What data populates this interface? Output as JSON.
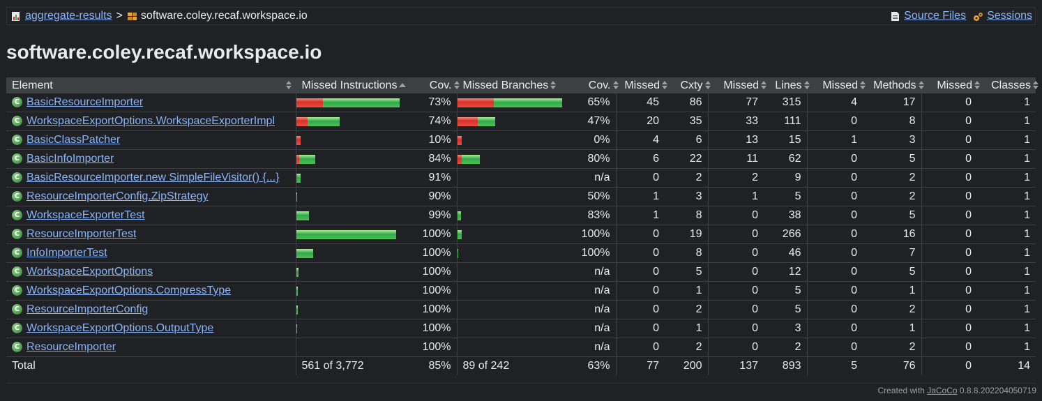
{
  "breadcrumb": {
    "root": "aggregate-results",
    "separator": ">",
    "current": "software.coley.recaf.workspace.io",
    "source_files": "Source Files",
    "sessions": "Sessions"
  },
  "page_title": "software.coley.recaf.workspace.io",
  "headers": [
    "Element",
    "Missed Instructions",
    "Cov.",
    "Missed Branches",
    "Cov.",
    "Missed",
    "Cxty",
    "Missed",
    "Lines",
    "Missed",
    "Methods",
    "Missed",
    "Classes"
  ],
  "rows": [
    {
      "name": "BasicResourceImporter",
      "instr": {
        "red": 38,
        "green": 110
      },
      "instr_cov": "73%",
      "br": {
        "red": 52,
        "green": 98
      },
      "br_cov": "65%",
      "cx_missed": "45",
      "cxty": "86",
      "ln_missed": "77",
      "lines": "315",
      "m_missed": "4",
      "methods": "17",
      "c_missed": "0",
      "classes": "1"
    },
    {
      "name": "WorkspaceExportOptions.WorkspaceExporterImpl",
      "instr": {
        "red": 16,
        "green": 46
      },
      "instr_cov": "74%",
      "br": {
        "red": 29,
        "green": 25
      },
      "br_cov": "47%",
      "cx_missed": "20",
      "cxty": "35",
      "ln_missed": "33",
      "lines": "111",
      "m_missed": "0",
      "methods": "8",
      "c_missed": "0",
      "classes": "1"
    },
    {
      "name": "BasicClassPatcher",
      "instr": {
        "red": 6,
        "green": 0
      },
      "instr_cov": "10%",
      "br": {
        "red": 6,
        "green": 0
      },
      "br_cov": "0%",
      "cx_missed": "4",
      "cxty": "6",
      "ln_missed": "13",
      "lines": "15",
      "m_missed": "1",
      "methods": "3",
      "c_missed": "0",
      "classes": "1"
    },
    {
      "name": "BasicInfoImporter",
      "instr": {
        "red": 4,
        "green": 23
      },
      "instr_cov": "84%",
      "br": {
        "red": 6,
        "green": 26
      },
      "br_cov": "80%",
      "cx_missed": "6",
      "cxty": "22",
      "ln_missed": "11",
      "lines": "62",
      "m_missed": "0",
      "methods": "5",
      "c_missed": "0",
      "classes": "1"
    },
    {
      "name": "BasicResourceImporter.new SimpleFileVisitor() {...}",
      "instr": {
        "red": 1,
        "green": 5
      },
      "instr_cov": "91%",
      "br": null,
      "br_cov": "n/a",
      "cx_missed": "0",
      "cxty": "2",
      "ln_missed": "2",
      "lines": "9",
      "m_missed": "0",
      "methods": "2",
      "c_missed": "0",
      "classes": "1"
    },
    {
      "name": "ResourceImporterConfig.ZipStrategy",
      "instr": {
        "red": 0,
        "green": 1
      },
      "instr_cov": "90%",
      "br": null,
      "br_cov": "50%",
      "cx_missed": "1",
      "cxty": "3",
      "ln_missed": "1",
      "lines": "5",
      "m_missed": "0",
      "methods": "2",
      "c_missed": "0",
      "classes": "1"
    },
    {
      "name": "WorkspaceExporterTest",
      "instr": {
        "red": 0,
        "green": 18
      },
      "instr_cov": "99%",
      "br": {
        "red": 0,
        "green": 5
      },
      "br_cov": "83%",
      "cx_missed": "1",
      "cxty": "8",
      "ln_missed": "0",
      "lines": "38",
      "m_missed": "0",
      "methods": "5",
      "c_missed": "0",
      "classes": "1"
    },
    {
      "name": "ResourceImporterTest",
      "instr": {
        "red": 0,
        "green": 143
      },
      "instr_cov": "100%",
      "br": {
        "red": 0,
        "green": 6
      },
      "br_cov": "100%",
      "cx_missed": "0",
      "cxty": "19",
      "ln_missed": "0",
      "lines": "266",
      "m_missed": "0",
      "methods": "16",
      "c_missed": "0",
      "classes": "1"
    },
    {
      "name": "InfoImporterTest",
      "instr": {
        "red": 0,
        "green": 24
      },
      "instr_cov": "100%",
      "br": {
        "red": 0,
        "green": 1
      },
      "br_cov": "100%",
      "cx_missed": "0",
      "cxty": "8",
      "ln_missed": "0",
      "lines": "46",
      "m_missed": "0",
      "methods": "7",
      "c_missed": "0",
      "classes": "1"
    },
    {
      "name": "WorkspaceExportOptions",
      "instr": {
        "red": 0,
        "green": 3
      },
      "instr_cov": "100%",
      "br": null,
      "br_cov": "n/a",
      "cx_missed": "0",
      "cxty": "5",
      "ln_missed": "0",
      "lines": "12",
      "m_missed": "0",
      "methods": "5",
      "c_missed": "0",
      "classes": "1"
    },
    {
      "name": "WorkspaceExportOptions.CompressType",
      "instr": {
        "red": 0,
        "green": 2
      },
      "instr_cov": "100%",
      "br": null,
      "br_cov": "n/a",
      "cx_missed": "0",
      "cxty": "1",
      "ln_missed": "0",
      "lines": "5",
      "m_missed": "0",
      "methods": "1",
      "c_missed": "0",
      "classes": "1"
    },
    {
      "name": "ResourceImporterConfig",
      "instr": {
        "red": 0,
        "green": 2
      },
      "instr_cov": "100%",
      "br": null,
      "br_cov": "n/a",
      "cx_missed": "0",
      "cxty": "2",
      "ln_missed": "0",
      "lines": "5",
      "m_missed": "0",
      "methods": "2",
      "c_missed": "0",
      "classes": "1"
    },
    {
      "name": "WorkspaceExportOptions.OutputType",
      "instr": {
        "red": 0,
        "green": 1
      },
      "instr_cov": "100%",
      "br": null,
      "br_cov": "n/a",
      "cx_missed": "0",
      "cxty": "1",
      "ln_missed": "0",
      "lines": "3",
      "m_missed": "0",
      "methods": "1",
      "c_missed": "0",
      "classes": "1"
    },
    {
      "name": "ResourceImporter",
      "instr": null,
      "instr_cov": "100%",
      "br": null,
      "br_cov": "n/a",
      "cx_missed": "0",
      "cxty": "2",
      "ln_missed": "0",
      "lines": "2",
      "m_missed": "0",
      "methods": "2",
      "c_missed": "0",
      "classes": "1"
    }
  ],
  "total": {
    "label": "Total",
    "instr": "561 of 3,772",
    "instr_cov": "85%",
    "br": "89 of 242",
    "br_cov": "63%",
    "cx_missed": "77",
    "cxty": "200",
    "ln_missed": "137",
    "lines": "893",
    "m_missed": "5",
    "methods": "76",
    "c_missed": "0",
    "classes": "14"
  },
  "footer": {
    "prefix": "Created with",
    "link": "JaCoCo",
    "suffix": "0.8.8.202204050719"
  },
  "icons": {
    "report": "report-icon",
    "package": "package-icon",
    "source": "source-files-icon",
    "session": "session-icon",
    "class": "class-icon"
  },
  "colors": {
    "background": "#202124",
    "link": "#8ab4f8",
    "missed": "#d93025",
    "covered": "#34a853",
    "header": "#3c4043"
  }
}
